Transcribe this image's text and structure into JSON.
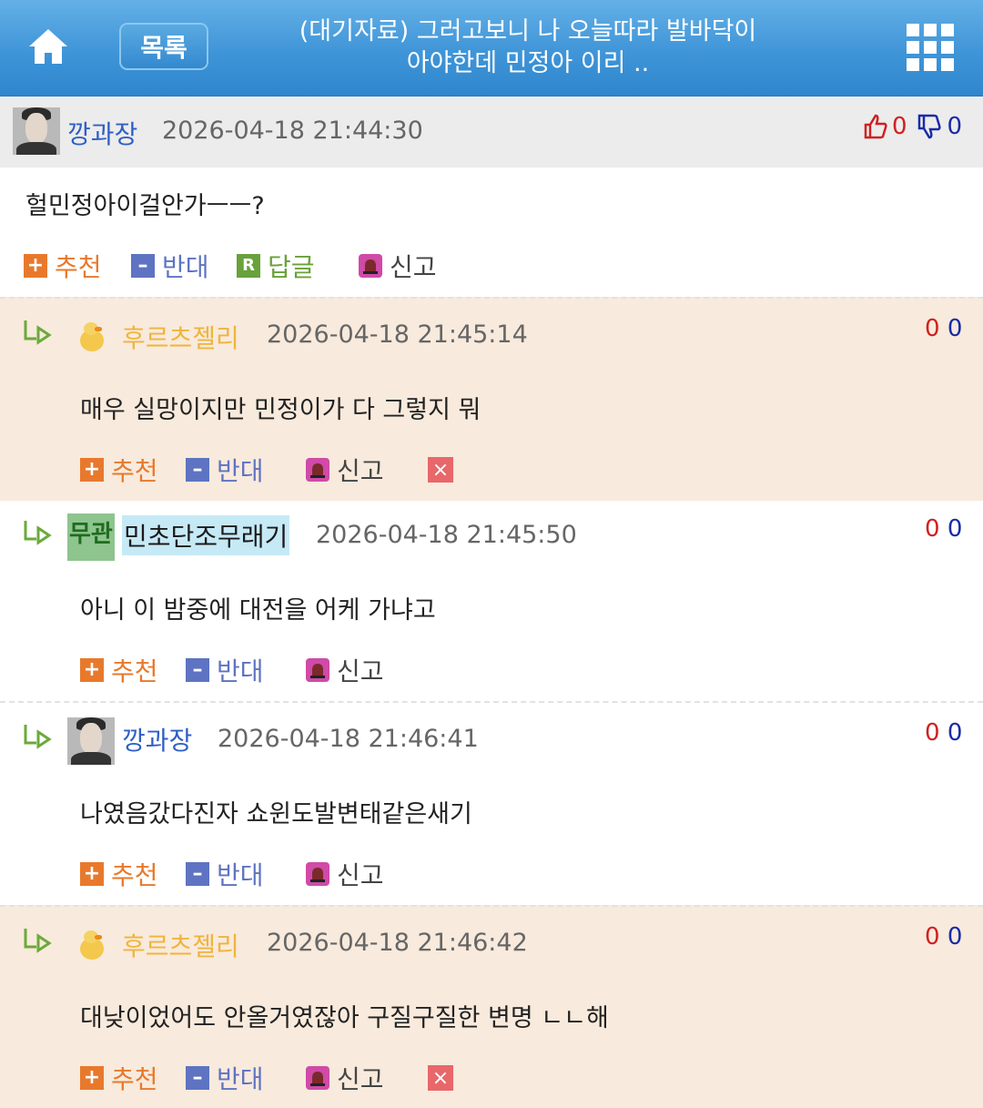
{
  "header": {
    "list_label": "목록",
    "title_line1": "(대기자료) 그러고보니 나 오늘따라 발바닥이",
    "title_line2": "아야한데 민정아 이리 ..",
    "home_icon": "home-icon",
    "menu_icon": "grid-menu-icon"
  },
  "post": {
    "author": "깡과장",
    "date": "2026-04-18 21:44:30",
    "up": "0",
    "down": "0",
    "text": "헐민정아이걸안가ㅡㅡ?",
    "actions": {
      "recommend": "추천",
      "oppose": "반대",
      "reply": "답글",
      "report": "신고"
    }
  },
  "comments": [
    {
      "author": "후르츠젤리",
      "date": "2026-04-18 21:45:14",
      "up": "0",
      "down": "0",
      "text": "매우 실망이지만 민정이가 다 그렇지 뭐",
      "recommend": "추천",
      "oppose": "반대",
      "report": "신고",
      "deletable": true
    },
    {
      "author": "민초단조무래기",
      "date": "2026-04-18 21:45:50",
      "up": "0",
      "down": "0",
      "text": "아니 이 밤중에 대전을 어케 가냐고",
      "recommend": "추천",
      "oppose": "반대",
      "report": "신고",
      "deletable": false
    },
    {
      "author": "깡과장",
      "date": "2026-04-18 21:46:41",
      "up": "0",
      "down": "0",
      "text": "나였음갔다진자 쇼윈도발변태같은새기",
      "recommend": "추천",
      "oppose": "반대",
      "report": "신고",
      "deletable": false
    },
    {
      "author": "후르츠젤리",
      "date": "2026-04-18 21:46:42",
      "up": "0",
      "down": "0",
      "text": "대낮이었어도 안올거였잖아 구질구질한 변명 ㄴㄴ해",
      "recommend": "추천",
      "oppose": "반대",
      "report": "신고",
      "deletable": true
    }
  ],
  "avatar_labels": {
    "minchodan": "무관"
  },
  "colors": {
    "header": "#3f95d8",
    "peach": "#f8eadc",
    "nick_blue": "#2f5fc4",
    "nick_orange": "#f0b43c",
    "vote_up": "#d02020",
    "vote_down": "#1a2ba8"
  }
}
